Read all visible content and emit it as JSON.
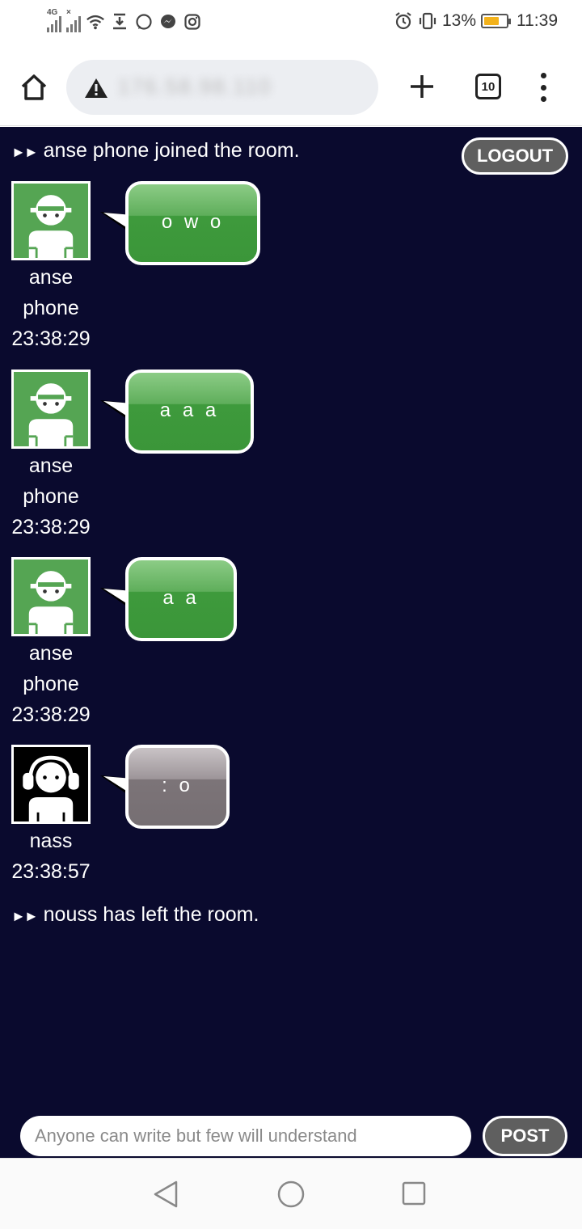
{
  "status_bar": {
    "network": "4G",
    "battery": "13%",
    "battery_level": 0.13,
    "time": "11:39",
    "icons": [
      "signal-icon",
      "signal-x-icon",
      "wifi-icon",
      "download-icon",
      "whatsapp-icon",
      "messenger-icon",
      "instagram-icon",
      "alarm-icon",
      "vibrate-icon",
      "battery-icon"
    ]
  },
  "browser": {
    "url": "176.58.98.110",
    "tab_count": "10"
  },
  "chat": {
    "system_messages": [
      {
        "arrows": "►►",
        "text": "anse phone joined the room."
      },
      {
        "arrows": "►►",
        "text": "nouss has left the room."
      }
    ],
    "logout_label": "LOGOUT",
    "messages": [
      {
        "user_line1": "anse",
        "user_line2": "phone",
        "time": "23:38:29",
        "text": "o w o",
        "color": "green"
      },
      {
        "user_line1": "anse",
        "user_line2": "phone",
        "time": "23:38:29",
        "text": "a a a",
        "color": "green"
      },
      {
        "user_line1": "anse",
        "user_line2": "phone",
        "time": "23:38:29",
        "text": "a a",
        "color": "green"
      },
      {
        "user_line1": "nass",
        "user_line2": "",
        "time": "23:38:57",
        "text": ": o",
        "color": "gray"
      }
    ],
    "input_placeholder": "Anyone can write but few will understand",
    "post_label": "POST"
  },
  "colors": {
    "chat_background": "#0a0a2e",
    "green_avatar": "#55a553",
    "bubble_green": "#3e9a3c",
    "bubble_gray": "#7c7478",
    "button_gray": "#5f5f5f"
  }
}
